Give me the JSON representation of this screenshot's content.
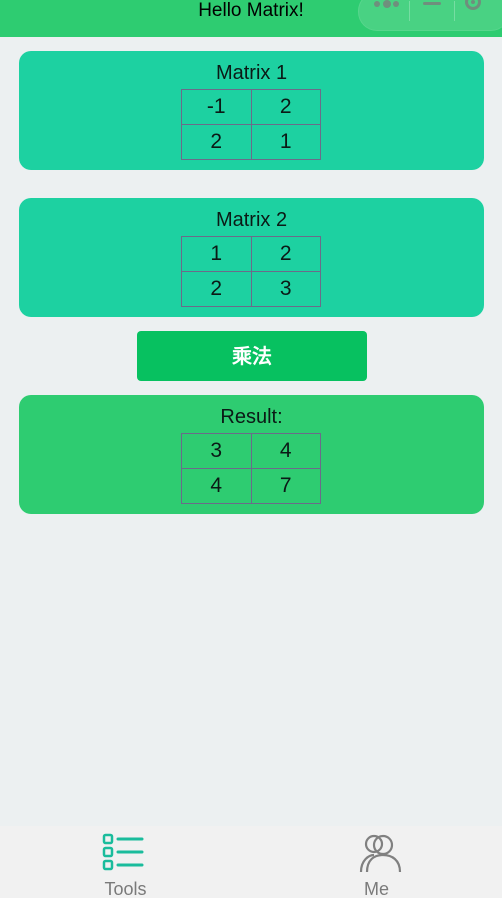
{
  "nav": {
    "title": "Hello Matrix!"
  },
  "matrix1": {
    "title": "Matrix 1",
    "rows": [
      [
        "-1",
        "2"
      ],
      [
        "2",
        "1"
      ]
    ]
  },
  "matrix2": {
    "title": "Matrix 2",
    "rows": [
      [
        "1",
        "2"
      ],
      [
        "2",
        "3"
      ]
    ]
  },
  "action": {
    "multiply_label": "乘法"
  },
  "result": {
    "title": "Result:",
    "rows": [
      [
        "3",
        "4"
      ],
      [
        "4",
        "7"
      ]
    ]
  },
  "tabbar": {
    "tabs": [
      {
        "label": "Tools",
        "icon": "list-icon",
        "active": true
      },
      {
        "label": "Me",
        "icon": "user-group-icon",
        "active": false
      }
    ]
  },
  "colors": {
    "nav_bg": "#2ecc71",
    "matrix_card_bg": "#1dd1a1",
    "result_card_bg": "#2ecc71",
    "button_bg": "#07c160",
    "active_icon": "#1abc9c"
  }
}
